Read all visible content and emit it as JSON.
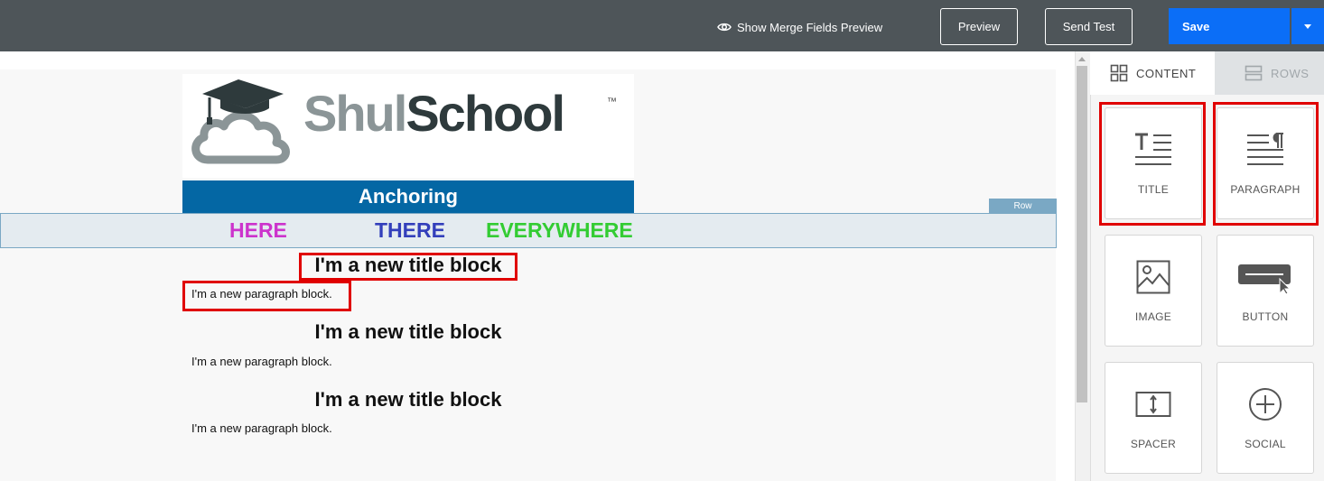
{
  "toolbar": {
    "merge_preview_label": "Show Merge Fields Preview",
    "preview_label": "Preview",
    "send_test_label": "Send Test",
    "save_label": "Save"
  },
  "email": {
    "logo": {
      "part1": "Shul",
      "part2": "School",
      "tm": "™"
    },
    "header_title": "Anchoring",
    "row_badge": "Row",
    "words": [
      "HERE",
      "THERE",
      "EVERYWHERE"
    ],
    "blocks": [
      {
        "title": "I'm a new title block",
        "paragraph": "I'm a new paragraph block."
      },
      {
        "title": "I'm a new title block",
        "paragraph": "I'm a new paragraph block."
      },
      {
        "title": "I'm a new title block",
        "paragraph": "I'm a new paragraph block."
      }
    ]
  },
  "panel": {
    "tabs": [
      {
        "label": "CONTENT",
        "icon": "grid-icon",
        "active": true
      },
      {
        "label": "ROWS",
        "icon": "rows-icon",
        "active": false
      }
    ],
    "tiles": [
      {
        "label": "TITLE",
        "icon": "title-icon"
      },
      {
        "label": "PARAGRAPH",
        "icon": "paragraph-icon"
      },
      {
        "label": "IMAGE",
        "icon": "image-icon"
      },
      {
        "label": "BUTTON",
        "icon": "button-icon"
      },
      {
        "label": "SPACER",
        "icon": "spacer-icon"
      },
      {
        "label": "SOCIAL",
        "icon": "social-icon"
      }
    ]
  },
  "colors": {
    "toolbar_bg": "#4e5559",
    "save_blue": "#0b6ef7",
    "header_blue": "#0467a4",
    "highlight_red": "#e00000",
    "here": "#cc33cc",
    "there": "#333fbb",
    "everywhere": "#33cc33"
  }
}
